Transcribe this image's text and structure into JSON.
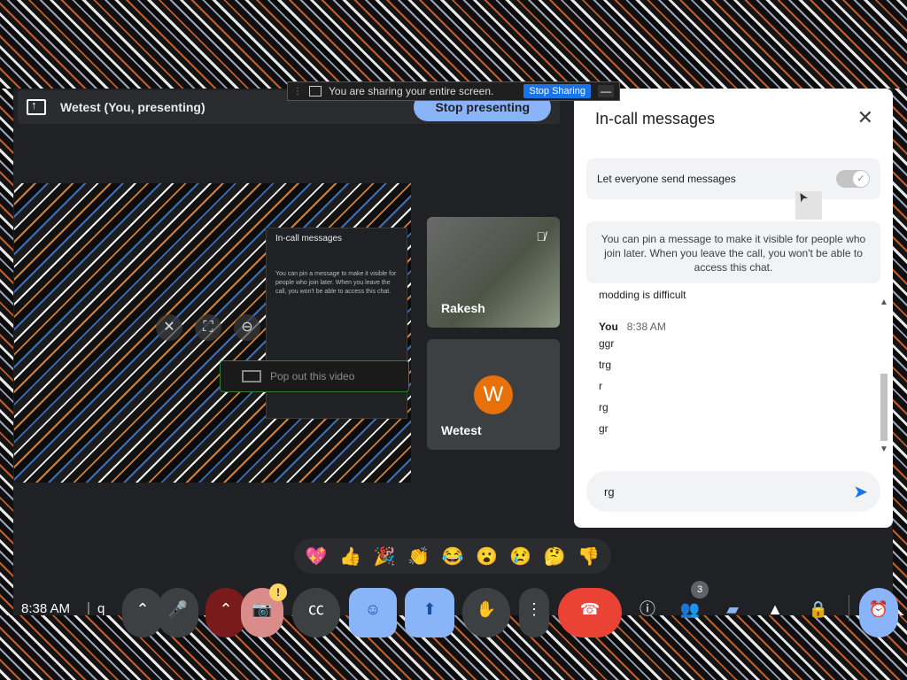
{
  "share_bar": {
    "text": "You are sharing your entire screen.",
    "stop_sharing_label": "Stop Sharing",
    "minimize_label": "—"
  },
  "presenting": {
    "title": "Wetest (You, presenting)",
    "stop_label": "Stop presenting"
  },
  "screen_tile": {
    "mini_panel_title": "In-call messages",
    "mini_panel_text": "You can pin a message to make it visible for people who join later. When you leave the call, you won't be able to access this chat.",
    "popout_label": "Pop out this video"
  },
  "participants": [
    {
      "name": "Rakesh",
      "muted": true
    },
    {
      "name": "Wetest",
      "avatar_letter": "W",
      "avatar_color": "#e8710a"
    }
  ],
  "chat": {
    "title": "In-call messages",
    "setting_label": "Let everyone send messages",
    "setting_enabled": true,
    "pin_note": "You can pin a message to make it visible for people who join later. When you leave the call, you won't be able to access this chat.",
    "previous_message": "modding is difficult",
    "sender": "You",
    "time": "8:38 AM",
    "messages": [
      "ggr",
      "trg",
      "r",
      "rg",
      "gr"
    ],
    "input_value": "rg"
  },
  "reactions": [
    "💖",
    "👍",
    "🎉",
    "👏",
    "😂",
    "😮",
    "😢",
    "🤔",
    "👎"
  ],
  "toolbar": {
    "clock": "8:38 AM",
    "separator": "|",
    "meet_code": "q",
    "participant_count": "3",
    "warning_badge": "!",
    "icons": {
      "more_options": "up-chevron-icon",
      "mic": "mic-icon",
      "camera": "camera-off-icon",
      "captions": "captions-icon",
      "emoji": "emoji-icon",
      "present": "present-icon",
      "hand": "raise-hand-icon",
      "more": "more-vert-icon",
      "end_call": "end-call-icon",
      "info": "info-icon",
      "people": "people-icon",
      "chat": "chat-icon",
      "activities": "activities-icon",
      "host_controls": "lock-person-icon",
      "timer": "timer-icon"
    }
  },
  "colors": {
    "accent": "#8ab4f8",
    "end_call": "#ea4335",
    "background": "#202124"
  }
}
